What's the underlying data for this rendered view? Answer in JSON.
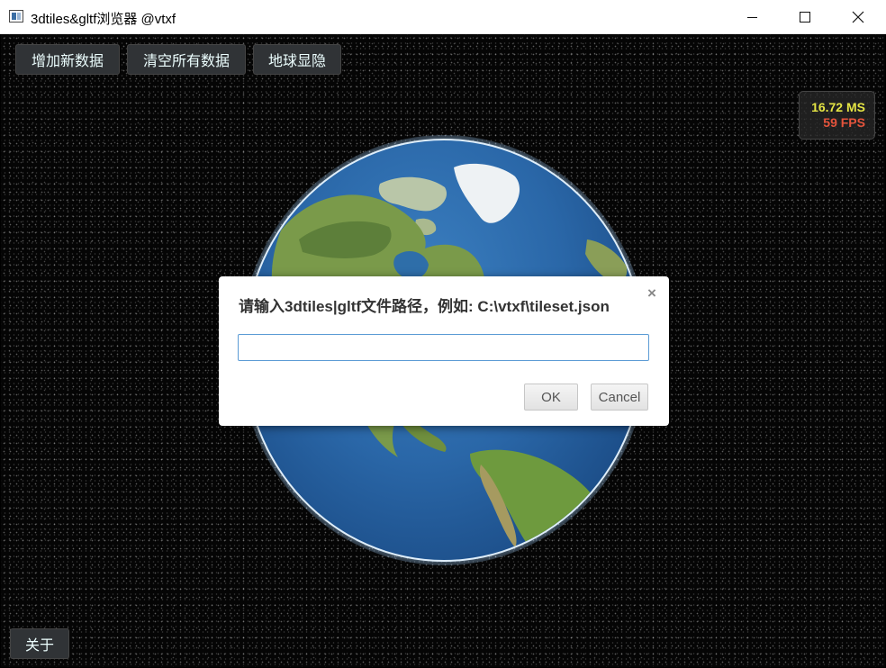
{
  "window": {
    "title": "3dtiles&gltf浏览器 @vtxf",
    "icon": "app-window-icon",
    "controls": [
      "minimize-icon",
      "maximize-icon",
      "close-icon"
    ]
  },
  "toolbar": {
    "add_data_label": "增加新数据",
    "clear_all_label": "清空所有数据",
    "toggle_globe_label": "地球显隐"
  },
  "performance": {
    "frame_time": "16.72 MS",
    "fps": "59 FPS",
    "colors": {
      "frame_time": "#e5e544",
      "fps": "#e5543c"
    }
  },
  "dialog": {
    "prompt": "请输入3dtiles|gltf文件路径，例如: C:\\vtxf\\tileset.json",
    "close_glyph": "×",
    "input_value": "",
    "ok_label": "OK",
    "cancel_label": "Cancel"
  },
  "footer": {
    "about_label": "关于"
  }
}
